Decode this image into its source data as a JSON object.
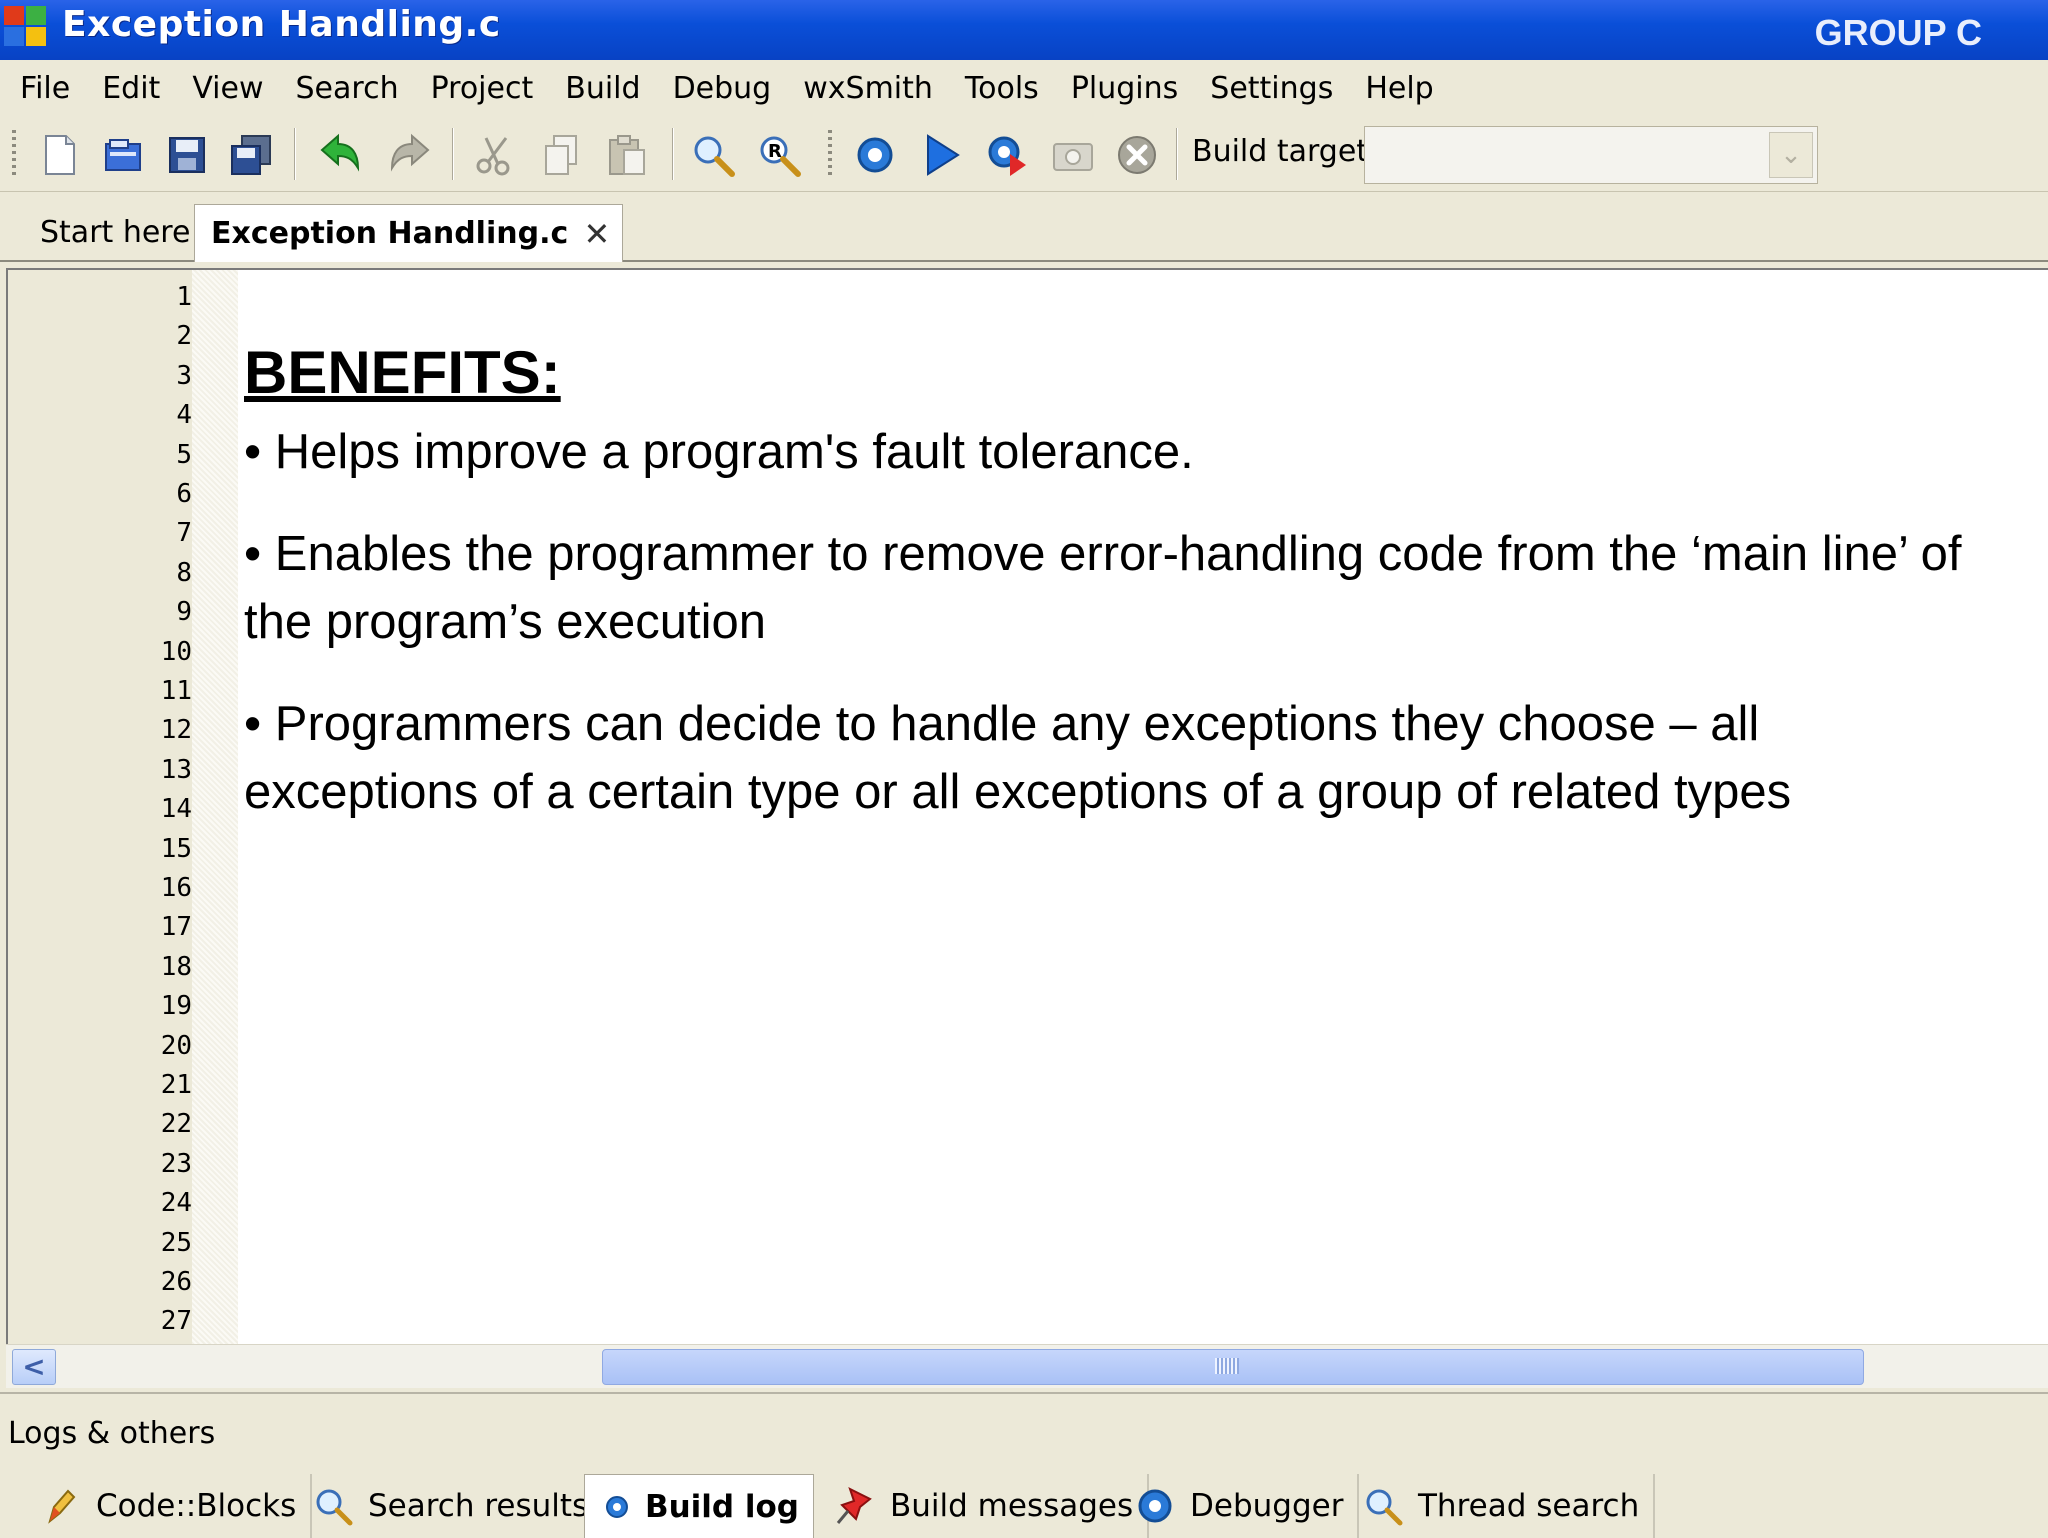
{
  "window": {
    "title": "Exception Handling.c",
    "group_label": "GROUP C"
  },
  "menu": [
    "File",
    "Edit",
    "View",
    "Search",
    "Project",
    "Build",
    "Debug",
    "wxSmith",
    "Tools",
    "Plugins",
    "Settings",
    "Help"
  ],
  "toolbar": {
    "build_target_label": "Build target:",
    "build_target_value": ""
  },
  "tabs": {
    "start": "Start here",
    "file": "Exception Handling.c",
    "close_glyph": "✕"
  },
  "editor": {
    "line_numbers": [
      "1",
      "2",
      "3",
      "4",
      "5",
      "6",
      "7",
      "8",
      "9",
      "10",
      "11",
      "12",
      "13",
      "14",
      "15",
      "16",
      "17",
      "18",
      "19",
      "20",
      "21",
      "22",
      "23",
      "24",
      "25",
      "26",
      "27"
    ],
    "heading": "BENEFITS:",
    "bullets": [
      "• Helps improve a program's fault tolerance.",
      "• Enables the programmer to remove error-handling code from the ‘main line’ of the program’s execution",
      "• Programmers can decide to handle any exceptions they choose – all exceptions of a certain type or all exceptions of a group of related types"
    ]
  },
  "scrollbar": {
    "left_arrow": "<",
    "thumb_grip": "IIII"
  },
  "logs": {
    "title": "Logs & others",
    "tabs": [
      "Code::Blocks",
      "Search results",
      "Build log",
      "Build messages",
      "Debugger",
      "Thread search"
    ],
    "active_tab": "Build log"
  }
}
